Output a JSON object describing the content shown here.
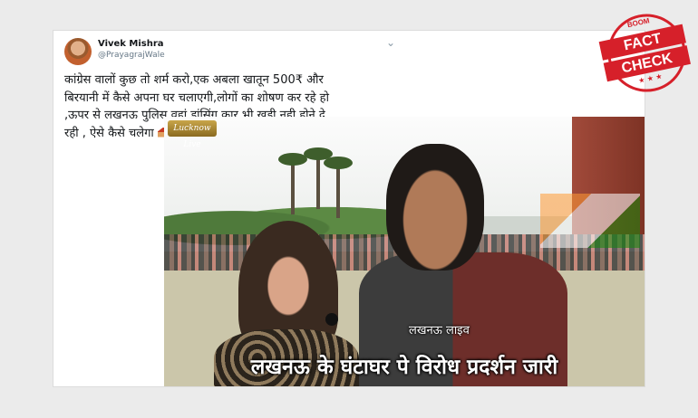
{
  "tweet": {
    "name": "Vivek Mishra",
    "handle": "@PrayagrajWale",
    "chevron": "⌄",
    "text": "कांग्रेस वालों कुछ तो शर्म करो,एक अबला खातून 500₹ और\nबिरयानी में कैसे अपना घर चलाएगी,लोगों का शोषण कर रहे हो\n,ऊपर से लखनऊ पुलिस वहां डांसिंग कार भी खड़ी नही होने दे\nरही , ऐसे कैसे चलेगा",
    "emoji": [
      "house-emoji",
      "house-emoji",
      "house-emoji",
      "house-emoji"
    ]
  },
  "video": {
    "logo_text": "Lucknow Live",
    "overlay_label": "लखनऊ लाइव",
    "caption": "लखनऊ के घंटाघर पे विरोध प्रदर्शन जारी"
  },
  "stamp": {
    "top": "BOOM",
    "line1": "FACT",
    "line2": "CHECK",
    "stars": "★ ★ ★",
    "color": "#d6202a"
  }
}
